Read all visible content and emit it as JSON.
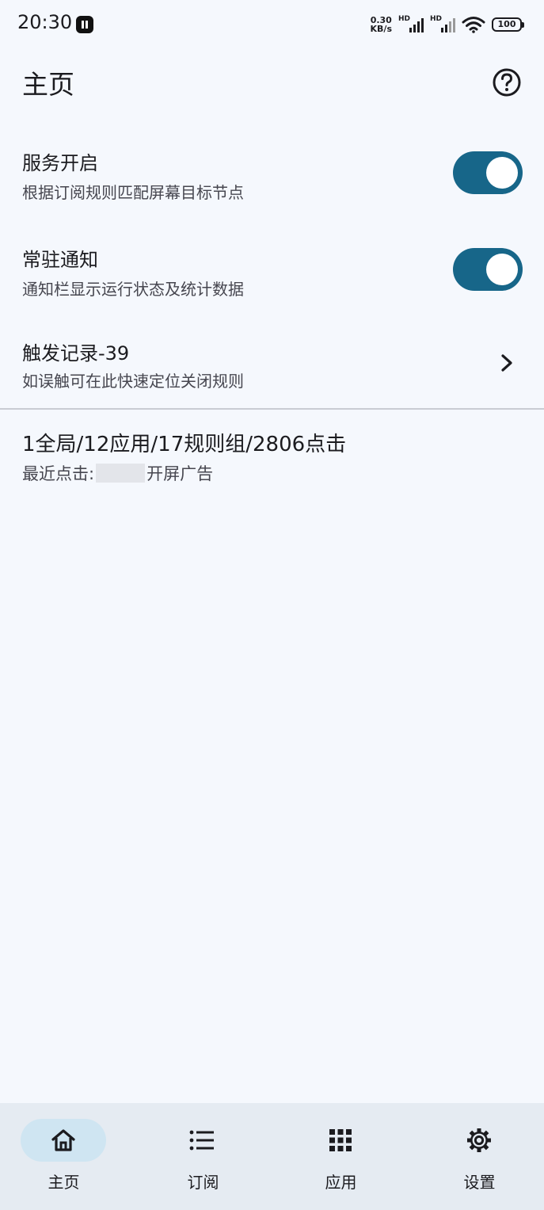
{
  "status_bar": {
    "time": "20:30",
    "net_speed_value": "0.30",
    "net_speed_unit": "KB/s",
    "signal_label": "HD",
    "battery": "100"
  },
  "header": {
    "title": "主页",
    "help_icon": "help-circle-icon"
  },
  "settings": {
    "service": {
      "title": "服务开启",
      "subtitle": "根据订阅规则匹配屏幕目标节点",
      "enabled": true
    },
    "notification": {
      "title": "常驻通知",
      "subtitle": "通知栏显示运行状态及统计数据",
      "enabled": true
    },
    "records": {
      "title": "触发记录-39",
      "subtitle": "如误触可在此快速定位关闭规则"
    }
  },
  "stats": {
    "summary": "1全局/12应用/17规则组/2806点击",
    "recent_label": "最近点击:",
    "recent_suffix": "开屏广告"
  },
  "colors": {
    "accent": "#176689",
    "background": "#f5f8fd",
    "nav_background": "#e5ebf2",
    "nav_active_pill": "#cfe5f2"
  },
  "nav": {
    "active": "home",
    "items": [
      {
        "label": "主页",
        "icon": "home-icon"
      },
      {
        "label": "订阅",
        "icon": "list-icon"
      },
      {
        "label": "应用",
        "icon": "apps-grid-icon"
      },
      {
        "label": "设置",
        "icon": "gear-icon"
      }
    ]
  }
}
